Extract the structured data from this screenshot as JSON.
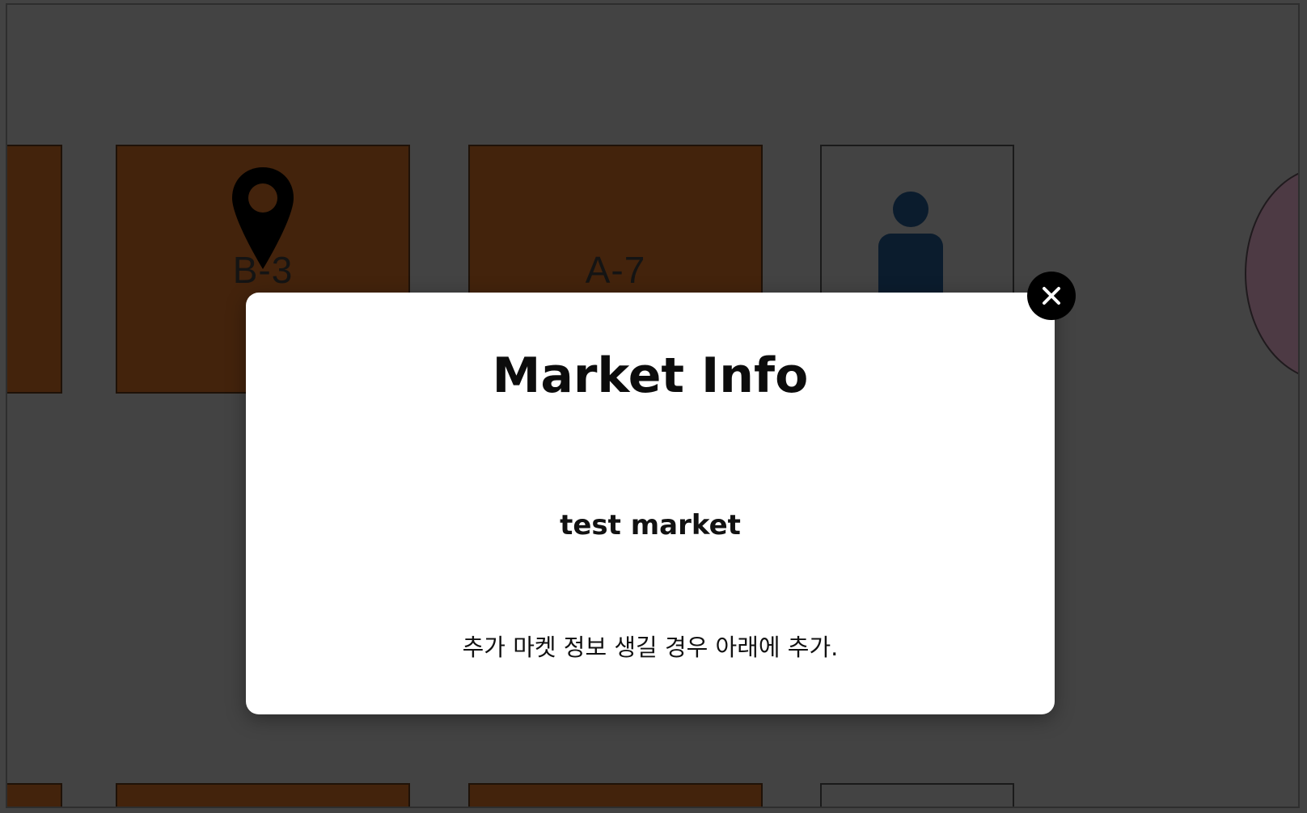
{
  "map": {
    "booths": [
      {
        "label": ""
      },
      {
        "label": "B-3"
      },
      {
        "label": "A-7"
      },
      {
        "label": ""
      },
      {
        "label": ""
      },
      {
        "label": ""
      }
    ]
  },
  "modal": {
    "title": "Market Info",
    "market_name": "test market",
    "note": "추가 마켓 정보 생길 경우 아래에 추가."
  },
  "icons": {
    "selected_booth": "map-pin-icon",
    "restroom": "person-icon",
    "close": "close-icon"
  },
  "colors": {
    "booth": "#43230c",
    "overlay_background": "#434343",
    "modal_background": "#ffffff",
    "close_button": "#000000"
  }
}
